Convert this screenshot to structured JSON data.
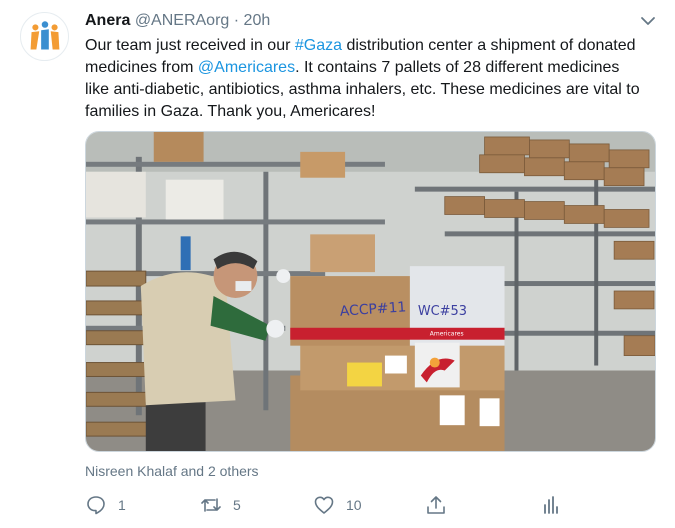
{
  "tweet": {
    "author_name": "Anera",
    "handle": "@ANERAorg",
    "separator": "·",
    "time": "20h",
    "text_segments": [
      {
        "text": "Our team just received in our ",
        "link": false
      },
      {
        "text": "#Gaza",
        "link": true
      },
      {
        "text": " distribution center a shipment of donated medicines from ",
        "link": false
      },
      {
        "text": "@Americares",
        "link": true
      },
      {
        "text": ". It contains 7 pallets of 28 different medicines like anti-diabetic, antibiotics, asthma inhalers, etc. These medicines are vital to families in Gaza. Thank you, Americares!",
        "link": false
      }
    ],
    "photo_box_labels": [
      "ACCP#11",
      "WC#53",
      "Americares"
    ],
    "liked_by": "Nisreen Khalaf and 2 others",
    "counts": {
      "replies": "1",
      "retweets": "5",
      "likes": "10"
    },
    "colors": {
      "link": "#1b95e0",
      "secondary": "#657786",
      "logo_orange": "#f39c34",
      "logo_blue": "#3b8fd0",
      "box_red": "#c8202f"
    },
    "icons": [
      "anera-logo",
      "chevron-down-icon",
      "reply-icon",
      "retweet-icon",
      "like-icon",
      "share-icon",
      "analytics-icon"
    ]
  }
}
